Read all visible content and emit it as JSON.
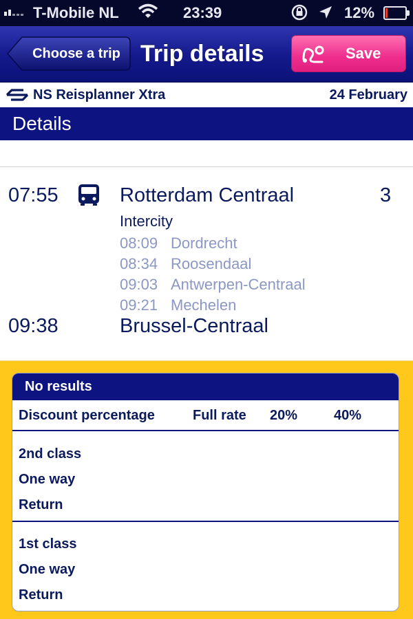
{
  "status_bar": {
    "carrier": "T-Mobile NL",
    "time": "23:39",
    "battery_percent_label": "12%",
    "battery_level": 0.12,
    "icons": [
      "signal-icon",
      "wifi-icon",
      "rotation-lock-icon",
      "location-arrow-icon",
      "battery-icon"
    ]
  },
  "nav": {
    "back_label": "Choose a trip",
    "title": "Trip details",
    "save_label": "Save",
    "save_icon": "route-icon"
  },
  "subheader": {
    "logo": "ns-logo-icon",
    "app_name": "NS Reisplanner Xtra",
    "date": "24 February"
  },
  "section_title": "Details",
  "trip": {
    "departure_time": "07:55",
    "mode_icon": "bus-icon",
    "departure_station": "Rotterdam Centraal",
    "platform": "3",
    "train_type": "Intercity",
    "stops": [
      {
        "time": "08:09",
        "station": "Dordrecht"
      },
      {
        "time": "08:34",
        "station": "Roosendaal"
      },
      {
        "time": "09:03",
        "station": "Antwerpen-Centraal"
      },
      {
        "time": "09:21",
        "station": "Mechelen"
      }
    ],
    "arrival_time": "09:38",
    "arrival_station": "Brussel-Centraal"
  },
  "prices": {
    "header": "No results",
    "columns": [
      "Discount percentage",
      "Full rate",
      "20%",
      "40%"
    ],
    "groups": [
      {
        "label": "2nd class",
        "rows": [
          "One way",
          "Return"
        ]
      },
      {
        "label": "1st class",
        "rows": [
          "One way",
          "Return"
        ]
      }
    ]
  },
  "colors": {
    "nav_blue": "#13198a",
    "text_navy": "#0a1a5c",
    "stop_grey_blue": "#8b97c4",
    "save_pink": "#ee2d8d",
    "ns_yellow": "#ffc81a"
  }
}
